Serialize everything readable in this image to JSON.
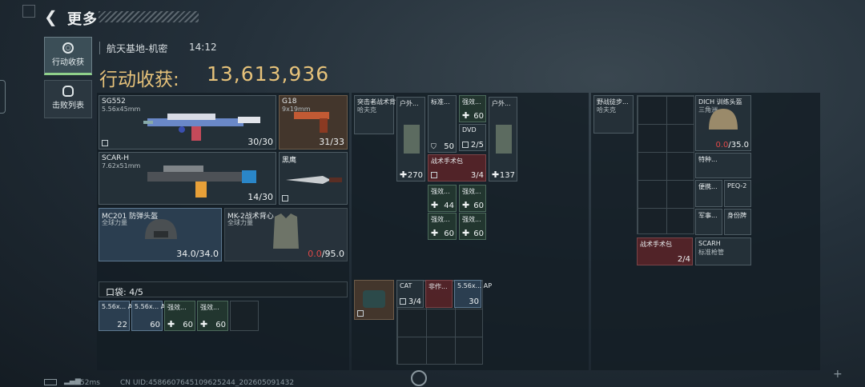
{
  "topbar": {
    "back_icon": "chevron-left-icon",
    "title": "更多"
  },
  "nav": [
    {
      "label": "行动收获",
      "icon": "target-icon",
      "active": true
    },
    {
      "label": "击败列表",
      "icon": "skull-icon",
      "active": false
    }
  ],
  "header": {
    "location": "航天基地-机密",
    "time": "14:12",
    "earnings_label": "行动收获:",
    "earnings_value": "13,613,936"
  },
  "loadout": {
    "weapons": [
      {
        "name": "SG552",
        "ammo": "5.56x45mm",
        "count": "30/30"
      },
      {
        "name": "G18",
        "ammo": "9x19mm",
        "count": "31/33"
      },
      {
        "name": "SCAR-H",
        "ammo": "7.62x51mm",
        "count": "14/30"
      },
      {
        "name": "黑鹰",
        "ammo": "",
        "count": ""
      }
    ],
    "helmet": {
      "name": "MC201 防弹头盔",
      "sub": "全球力量",
      "durability": "34.0/34.0"
    },
    "vest": {
      "name": "MK-2战术背心",
      "sub": "全球力量",
      "durability_now": "0.0",
      "durability_max": "/95.0"
    },
    "pocket": {
      "label": "口袋:",
      "value": "4/5"
    },
    "pocket_items": [
      {
        "name": "5.56x... AP",
        "count": "22"
      },
      {
        "name": "5.56x... AP",
        "count": "60"
      },
      {
        "name": "强效...",
        "count": "60"
      },
      {
        "name": "强效...",
        "count": "60"
      }
    ]
  },
  "bag": {
    "items": [
      {
        "name": "突击者战术背",
        "sub": "哈夫克"
      },
      {
        "name": "户外...",
        "count": "270"
      },
      {
        "name": "标准...",
        "count": "50"
      },
      {
        "name": "强效...",
        "count": "60"
      },
      {
        "name": "DVD",
        "count": "2/5"
      },
      {
        "name": "户外...",
        "count": "137"
      },
      {
        "name": "战术手术包",
        "count": "3/4"
      },
      {
        "name": "强效...",
        "count": "44"
      },
      {
        "name": "强效...",
        "count": "60"
      },
      {
        "name": "强效...",
        "count": "60"
      },
      {
        "name": "强效...",
        "count": "60"
      }
    ],
    "lower": [
      {
        "name": "CAT",
        "count": "3/4"
      },
      {
        "name": "非作..."
      },
      {
        "name": "5.56x... AP",
        "count": "30"
      }
    ]
  },
  "loot": {
    "items": [
      {
        "name": "野战徒步...",
        "sub": "哈夫克"
      },
      {
        "name": "DICH 训练头盔",
        "sub": "三角洲",
        "durability_now": "0.0",
        "durability_max": "/35.0"
      },
      {
        "name": "特种..."
      },
      {
        "name": "便携..."
      },
      {
        "name": "PEQ-2"
      },
      {
        "name": "军事..."
      },
      {
        "name": "身份牌"
      },
      {
        "name": "战术手术包",
        "count": "2/4"
      },
      {
        "name": "SCARH",
        "sub": "标准枪管"
      }
    ]
  },
  "footer": {
    "ping": "52ms",
    "uid": "CN UID:4586607645109625244_202605091432"
  },
  "colors": {
    "gold": "#e6c27a",
    "red": "#e04848",
    "accent_green": "#8fd08a"
  }
}
